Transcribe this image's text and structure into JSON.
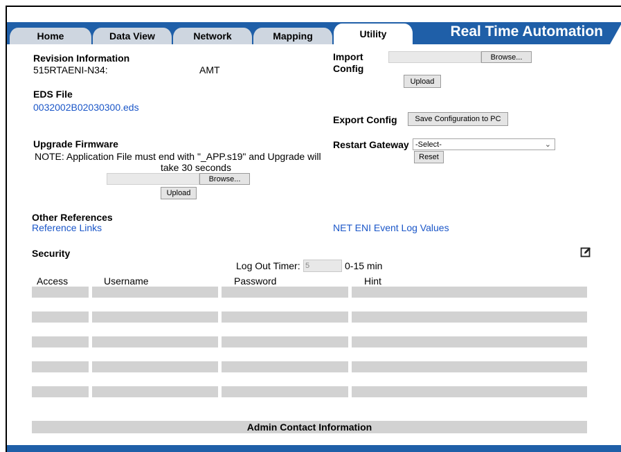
{
  "nav": {
    "tabs": [
      {
        "label": "Home"
      },
      {
        "label": "Data View"
      },
      {
        "label": "Network"
      },
      {
        "label": "Mapping"
      },
      {
        "label": "Utility"
      }
    ],
    "active_tab": "Utility",
    "brand": "Real Time Automation"
  },
  "revision": {
    "heading": "Revision Information",
    "model": "515RTAENI-N34:",
    "value": "AMT"
  },
  "eds": {
    "heading": "EDS File",
    "file_link": "0032002B02030300.eds"
  },
  "firmware": {
    "heading": "Upgrade Firmware",
    "note_line1": "NOTE: Application File must end with \"_APP.s19\" and Upgrade will",
    "note_line2": "take 30 seconds",
    "browse_label": "Browse...",
    "upload_label": "Upload"
  },
  "import_config": {
    "heading_line1": "Import",
    "heading_line2": "Config",
    "browse_label": "Browse...",
    "upload_label": "Upload"
  },
  "export_config": {
    "heading": "Export Config",
    "save_label": "Save Configuration to PC"
  },
  "restart": {
    "heading": "Restart Gateway",
    "selected": "-Select-",
    "reset_label": "Reset"
  },
  "references": {
    "heading": "Other References",
    "reference_links": "Reference Links",
    "event_log": "NET ENI Event Log Values"
  },
  "security": {
    "heading": "Security",
    "logout_label": "Log Out Timer:",
    "logout_value": "5",
    "logout_range": "0-15 min",
    "columns": [
      "Access",
      "Username",
      "Password",
      "Hint"
    ],
    "row_count": 5
  },
  "admin": {
    "label": "Admin Contact Information"
  }
}
